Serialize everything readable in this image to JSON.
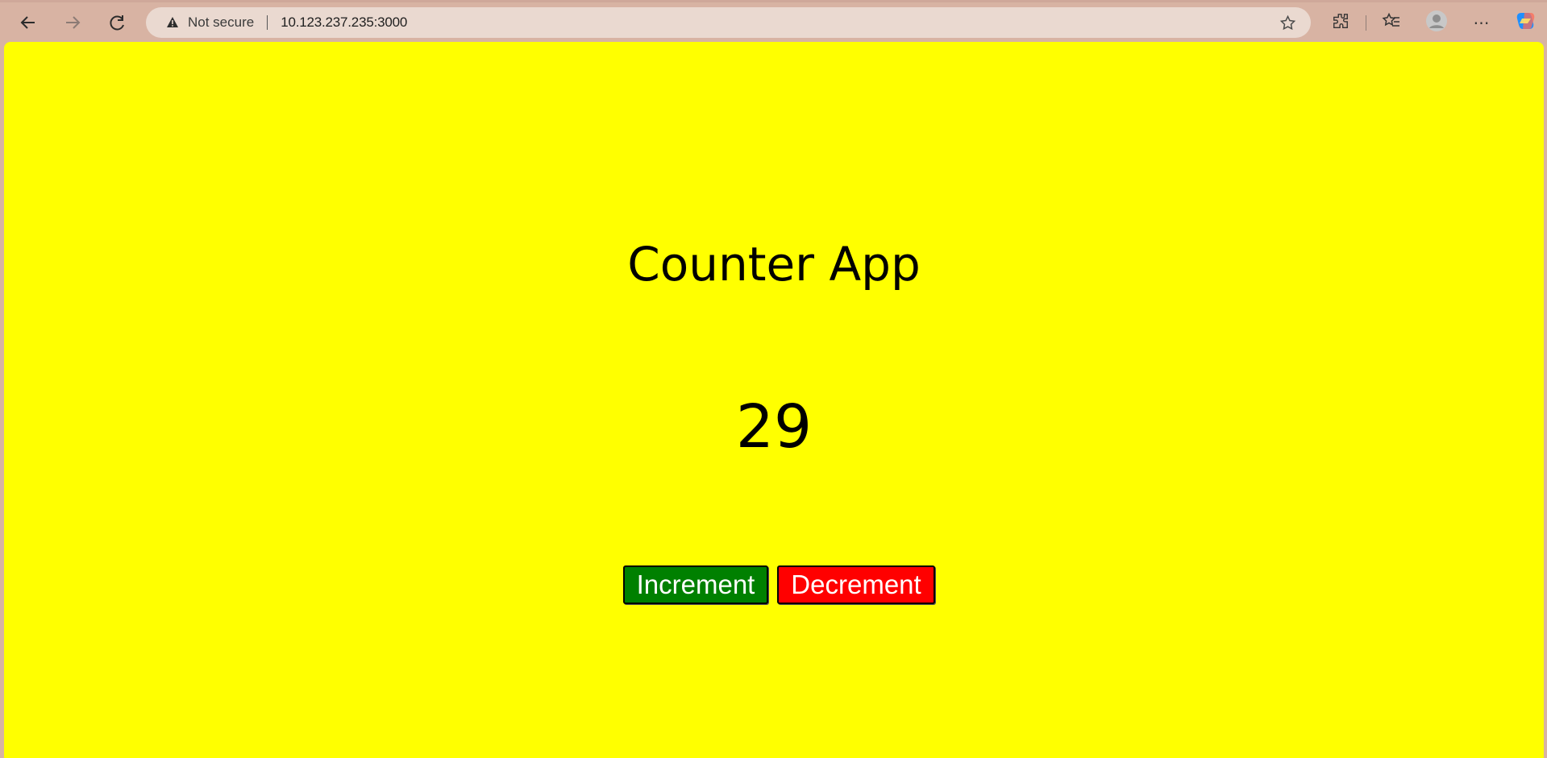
{
  "browser": {
    "address_bar": {
      "security_label": "Not secure",
      "url": "10.123.237.235:3000"
    },
    "icons": {
      "back": "back-arrow-icon",
      "forward": "forward-arrow-icon",
      "reload": "reload-icon",
      "warning": "warning-icon",
      "favorite": "star-icon",
      "extensions": "extensions-icon",
      "favorites": "favorites-icon",
      "profile": "profile-icon",
      "menu": "more-menu-icon",
      "copilot": "copilot-icon"
    }
  },
  "app": {
    "title": "Counter App",
    "count": "29",
    "buttons": {
      "increment": "Increment",
      "decrement": "Decrement"
    },
    "colors": {
      "background": "#ffff00",
      "increment": "#008000",
      "decrement": "#ff0000"
    }
  }
}
